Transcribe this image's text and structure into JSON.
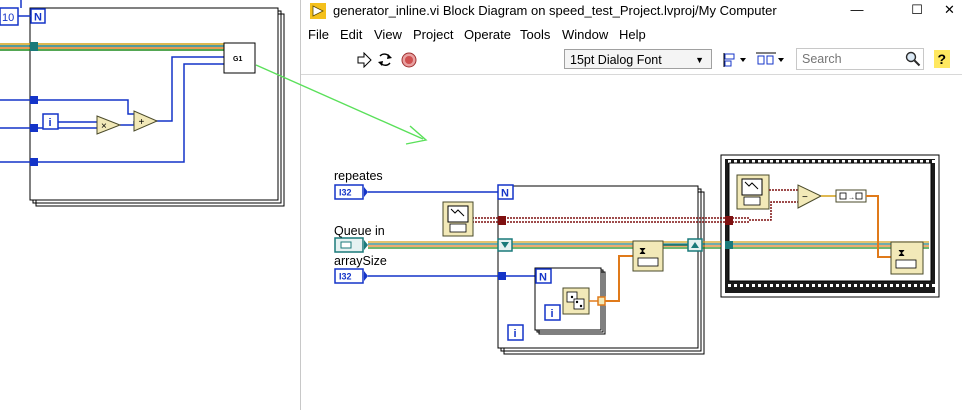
{
  "left_panel": {
    "const_value": "10",
    "n_label": "N",
    "i_label": "i",
    "g1_label": "G1"
  },
  "window": {
    "title": "generator_inline.vi Block Diagram on speed_test_Project.lvproj/My Computer",
    "controls": {
      "minimize": "—",
      "maximize": "☐",
      "close": "✕"
    }
  },
  "menu": {
    "items": [
      "File",
      "Edit",
      "View",
      "Project",
      "Operate",
      "Tools",
      "Window",
      "Help"
    ]
  },
  "toolbar": {
    "font_selected": "15pt Dialog Font",
    "search_placeholder": "Search"
  },
  "diagram": {
    "controls": {
      "repeates": "repeates",
      "queue_in": "Queue in",
      "array_size": "arraySize"
    },
    "i32": "I32",
    "n_label": "N",
    "i_label": "i"
  },
  "colors": {
    "int_wire": "#1434c8",
    "error_wire": "#7f1010",
    "refnum_wire": "#1a7a7a",
    "array_wire": "#e07a1a",
    "arrow": "#5ae05a",
    "frame": "#000000"
  }
}
